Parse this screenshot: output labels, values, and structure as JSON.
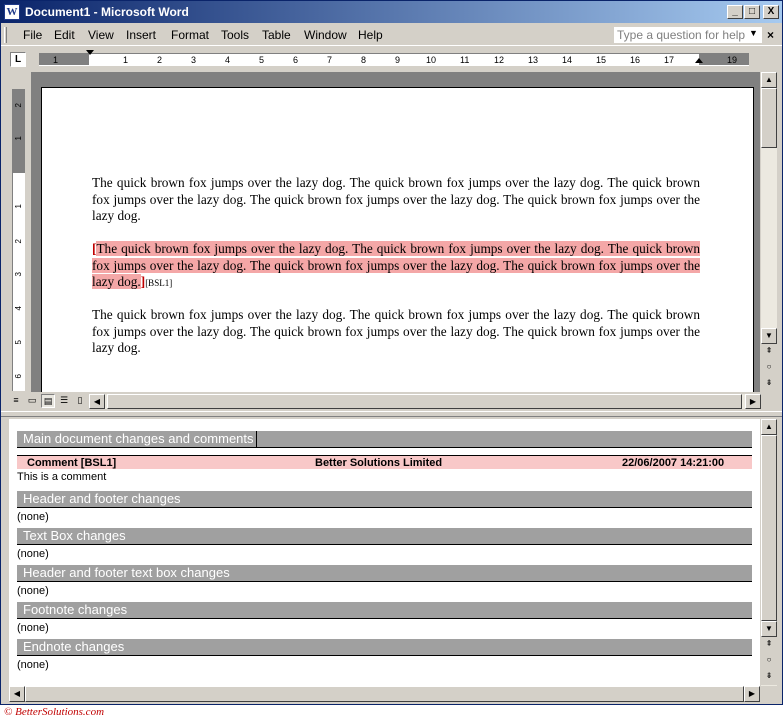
{
  "window": {
    "title": "Document1 - Microsoft Word",
    "minimize": "_",
    "maximize": "□",
    "close": "X"
  },
  "menubar": {
    "items": [
      "File",
      "Edit",
      "View",
      "Insert",
      "Format",
      "Tools",
      "Table",
      "Window",
      "Help"
    ],
    "help_placeholder": "Type a question for help",
    "help_arrow": "▼",
    "close_doc": "×"
  },
  "ruler": {
    "tab_selector": "L",
    "ticks": [
      "1",
      "1",
      "2",
      "3",
      "4",
      "5",
      "6",
      "7",
      "8",
      "9",
      "10",
      "11",
      "12",
      "13",
      "14",
      "15",
      "16",
      "17",
      "19"
    ],
    "vticks": [
      "2",
      "1",
      "1",
      "2",
      "3",
      "4",
      "5",
      "6"
    ]
  },
  "document": {
    "paragraph1": "The quick brown fox jumps over the lazy dog.  The quick brown fox jumps over the lazy dog.  The quick brown fox jumps over the lazy dog.  The quick brown fox jumps over the lazy dog.  The quick brown fox jumps over the lazy dog.",
    "paragraph2": "The quick brown fox jumps over the lazy dog.  The quick brown fox jumps over the lazy dog.  The quick brown fox jumps over the lazy dog.  The quick brown fox jumps over the lazy dog.  The quick brown fox jumps over the lazy dog.",
    "comment_marker": "[BSL1]",
    "paragraph3": "The quick brown fox jumps over the lazy dog.  The quick brown fox jumps over the lazy dog.  The quick brown fox jumps over the lazy dog.  The quick brown fox jumps over the lazy dog.  The quick brown fox jumps over the lazy dog.",
    "highlight_color": "#f4a7a7"
  },
  "reviewing_pane": {
    "main_header": "Main document changes and comments",
    "comment": {
      "label": "Comment [BSL1]",
      "author": "Better Solutions Limited",
      "datetime": "22/06/2007 14:21:00",
      "text": "This is a comment"
    },
    "sections": [
      {
        "title": "Header and footer changes",
        "content": "(none)"
      },
      {
        "title": "Text Box changes",
        "content": "(none)"
      },
      {
        "title": "Header and footer text box changes",
        "content": "(none)"
      },
      {
        "title": "Footnote changes",
        "content": "(none)"
      },
      {
        "title": "Endnote changes",
        "content": "(none)"
      }
    ]
  },
  "credit": "© BetterSolutions.com"
}
